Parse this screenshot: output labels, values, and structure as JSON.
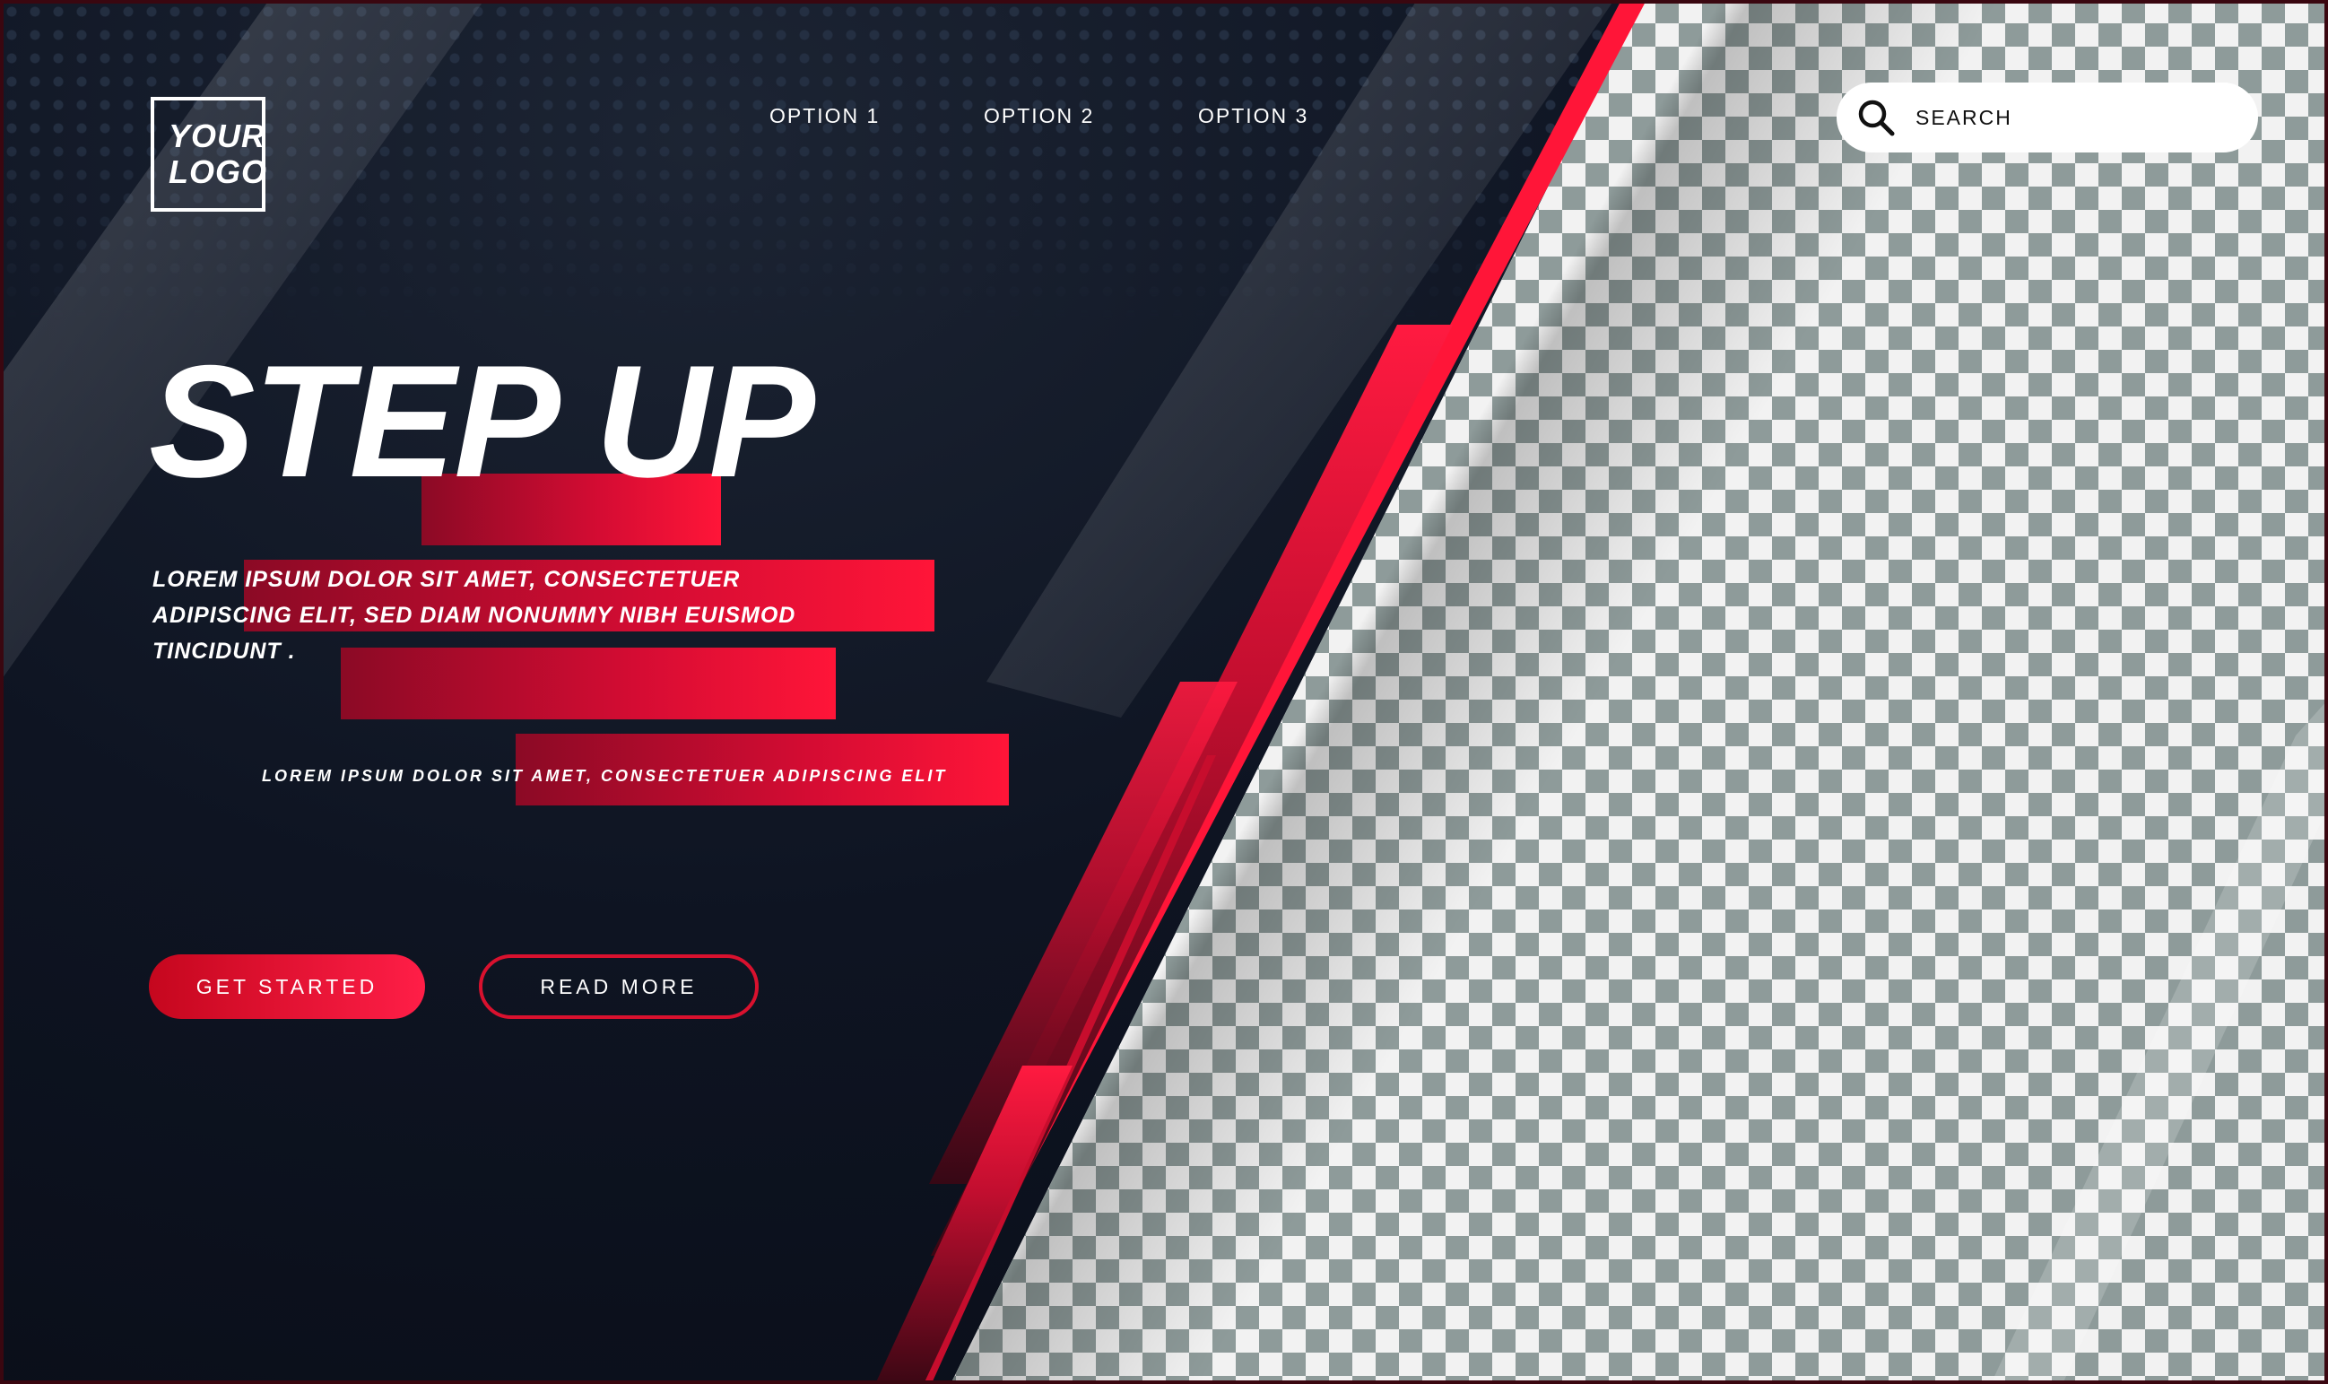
{
  "header": {
    "logo_line1": "YOUR",
    "logo_line2": "LOGO",
    "nav": [
      {
        "label": "OPTION 1"
      },
      {
        "label": "OPTION 2"
      },
      {
        "label": "OPTION 3"
      }
    ],
    "search": {
      "placeholder": "SEARCH"
    }
  },
  "hero": {
    "headline": "STEP UP",
    "lede": "LOREM IPSUM DOLOR SIT AMET, CONSECTETUER ADIPISCING ELIT, SED DIAM NONUMMY NIBH EUISMOD TINCIDUNT .",
    "tagline": "LOREM IPSUM DOLOR SIT AMET, CONSECTETUER ADIPISCING ELIT",
    "primary_button": "GET STARTED",
    "secondary_button": "READ MORE"
  },
  "colors": {
    "accent": "#ff1538",
    "dark": "#0b0f1a",
    "checker": "#8e9b9a"
  }
}
